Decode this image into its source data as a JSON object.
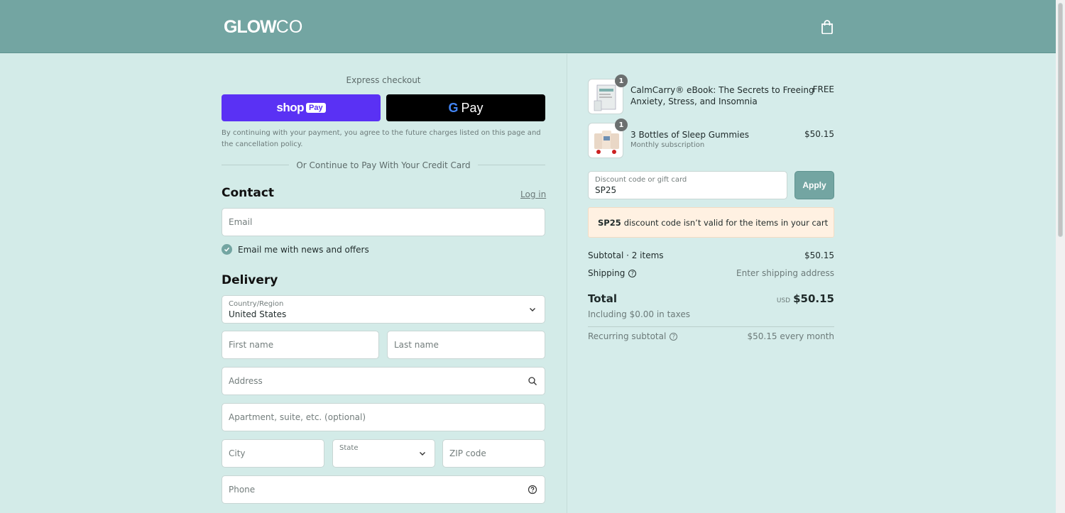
{
  "header": {
    "logo_bold": "GLOW",
    "logo_thin": "CO"
  },
  "express": {
    "label": "Express checkout",
    "shop_text": "shop",
    "shop_pay_badge": "Pay",
    "gpay_g": "G",
    "gpay_text": "Pay",
    "terms": "By continuing with your payment, you agree to the future charges listed on this page and the cancellation policy.",
    "divider": "Or Continue to Pay With Your Credit Card"
  },
  "contact": {
    "title": "Contact",
    "login": "Log in",
    "email_placeholder": "Email",
    "newsletter_label": "Email me with news and offers",
    "newsletter_checked": true
  },
  "delivery": {
    "title": "Delivery",
    "country_label": "Country/Region",
    "country_value": "United States",
    "first_name_placeholder": "First name",
    "last_name_placeholder": "Last name",
    "address_placeholder": "Address",
    "apartment_placeholder": "Apartment, suite, etc. (optional)",
    "city_placeholder": "City",
    "state_label": "State",
    "zip_placeholder": "ZIP code",
    "phone_placeholder": "Phone"
  },
  "cart": {
    "items": [
      {
        "qty": "1",
        "name_line1": "CalmCarry® eBook: The Secrets to Freeing",
        "name_line2": "Anxiety, Stress, and Insomnia",
        "price": "FREE"
      },
      {
        "qty": "1",
        "name_line1": "3 Bottles of Sleep Gummies",
        "subtitle": "Monthly subscription",
        "price": "$50.15"
      }
    ],
    "discount_label": "Discount code or gift card",
    "discount_value": "SP25",
    "apply_label": "Apply",
    "error_code": "SP25",
    "error_text": "discount code isn’t valid for the items in your cart"
  },
  "summary": {
    "subtotal_label": "Subtotal · 2 items",
    "subtotal_value": "$50.15",
    "shipping_label": "Shipping",
    "shipping_value": "Enter shipping address",
    "total_label": "Total",
    "currency": "USD",
    "total_value": "$50.15",
    "taxes": "Including $0.00 in taxes",
    "recurring_label": "Recurring subtotal",
    "recurring_value": "$50.15 every month"
  },
  "colors": {
    "header": "#73a5a2",
    "page_bg": "#d3ebe8",
    "shop_pay": "#5a31f4",
    "gpay": "#000000",
    "error_bg": "#fff1e2"
  }
}
